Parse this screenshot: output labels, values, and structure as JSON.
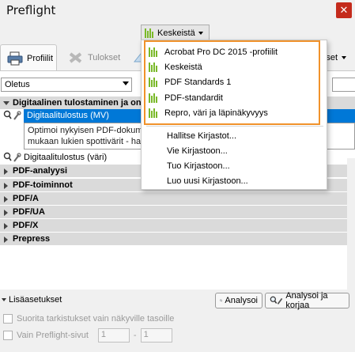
{
  "window": {
    "title": "Preflight",
    "close_label": "✕"
  },
  "library_button": {
    "label": "Keskeistä"
  },
  "tabs": {
    "profiles": "Profiilit",
    "results": "Tulokset",
    "options_suffix": "ukset"
  },
  "profile_filter": {
    "selected": "Oletus"
  },
  "groups": [
    {
      "label": "Digitaalinen tulostaminen ja onlin",
      "expanded": true
    },
    {
      "label": "PDF-analyysi",
      "expanded": false
    },
    {
      "label": "PDF-toiminnot",
      "expanded": false
    },
    {
      "label": "PDF/A",
      "expanded": false
    },
    {
      "label": "PDF/UA",
      "expanded": false
    },
    {
      "label": "PDF/X",
      "expanded": false
    },
    {
      "label": "Prepress",
      "expanded": false
    }
  ],
  "profiles": {
    "selected_label": "Digitaalitulostus (MV)",
    "description_line1": "Optimoi nykyisen PDF-dokumenti",
    "description_line2": "mukaan lukien spottivärit - harma",
    "second_label": "Digitaalitulostus (väri)"
  },
  "library_menu": {
    "libraries": [
      "Acrobat Pro DC 2015 -profiilit",
      "Keskeistä",
      "PDF Standards 1",
      "PDF-standardit",
      "Repro, väri ja läpinäkyvyys"
    ],
    "actions": [
      "Hallitse Kirjastot...",
      "Vie Kirjastoon...",
      "Tuo Kirjastoon...",
      "Luo uusi Kirjastoon..."
    ]
  },
  "bottom": {
    "more_settings": "Lisäasetukset",
    "analyze_button": "Analysoi",
    "analyze_fix_button": "Analysoi ja korjaa",
    "visible_layers_only": "Suorita tarkistukset vain näkyville tasoille",
    "pages_only": "Vain Preflight-sivut",
    "page_from": "1",
    "page_dash": "-",
    "page_to": "1"
  },
  "colors": {
    "accent_highlight": "#f0922b",
    "selection": "#0078d7",
    "library_icon": "#7ab929"
  }
}
